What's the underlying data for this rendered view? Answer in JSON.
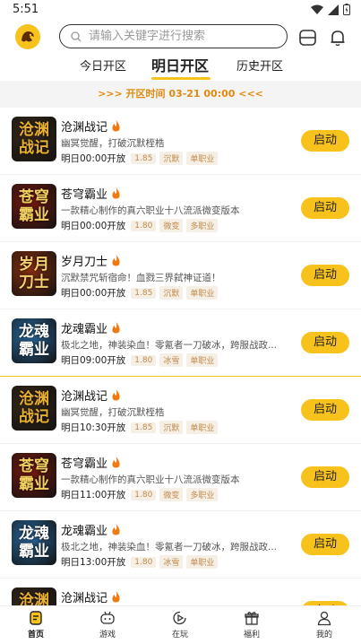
{
  "status": {
    "time": "5:51"
  },
  "header": {
    "search_placeholder": "请输入关键字进行搜索"
  },
  "tabs": [
    {
      "label": "今日开区",
      "active": false
    },
    {
      "label": "明日开区",
      "active": true
    },
    {
      "label": "历史开区",
      "active": false
    }
  ],
  "banner": {
    "text": ">>>  开区时间 03-21 00:00  <<<"
  },
  "start_label": "启动",
  "games": [
    {
      "title": "沧渊战记",
      "thumb": "沧渊战记",
      "thumb_color": "#e8b030",
      "thumb_bg": "#3a2a1a",
      "desc": "幽冥觉醒，打破沉默桎梏",
      "time": "明日00:00开放",
      "tags": [
        "1.85",
        "沉默",
        "单职业"
      ]
    },
    {
      "title": "苍穹霸业",
      "thumb": "苍穹霸业",
      "thumb_color": "#f2d060",
      "thumb_bg": "#7a1a10",
      "desc": "一款精心制作的真六职业十八流派微变版本",
      "time": "明日00:00开放",
      "tags": [
        "1.80",
        "微变",
        "多职业"
      ]
    },
    {
      "title": "岁月刀士",
      "thumb": "岁月刀士",
      "thumb_color": "#f6d070",
      "thumb_bg": "#8a3010",
      "desc": "沉默禁咒斩宿命！血戮三界弑神证道！",
      "time": "明日00:00开放",
      "tags": [
        "1.85",
        "沉默",
        "单职业"
      ]
    },
    {
      "title": "龙魂霸业",
      "thumb": "龙魂霸业",
      "thumb_color": "#ffffff",
      "thumb_bg": "#2a6aa0",
      "desc": "极北之地，神装染血！零氪者一刀破冰，跨服战政...",
      "time": "明日09:00开放",
      "tags": [
        "1.80",
        "冰雪",
        "单职业"
      ]
    },
    {
      "title": "沧渊战记",
      "thumb": "沧渊战记",
      "thumb_color": "#e8b030",
      "thumb_bg": "#3a2a1a",
      "desc": "幽冥觉醒，打破沉默桎梏",
      "time": "明日10:30开放",
      "tags": [
        "1.85",
        "沉默",
        "单职业"
      ]
    },
    {
      "title": "苍穹霸业",
      "thumb": "苍穹霸业",
      "thumb_color": "#f2d060",
      "thumb_bg": "#7a1a10",
      "desc": "一款精心制作的真六职业十八流派微变版本",
      "time": "明日11:00开放",
      "tags": [
        "1.80",
        "微变",
        "多职业"
      ]
    },
    {
      "title": "龙魂霸业",
      "thumb": "龙魂霸业",
      "thumb_color": "#ffffff",
      "thumb_bg": "#2a6aa0",
      "desc": "极北之地，神装染血！零氪者一刀破冰，跨服战政...",
      "time": "明日13:00开放",
      "tags": [
        "1.80",
        "冰雪",
        "单职业"
      ]
    },
    {
      "title": "沧渊战记",
      "thumb": "沧渊战记",
      "thumb_color": "#e8b030",
      "thumb_bg": "#3a2a1a",
      "desc": "",
      "time": "",
      "tags": []
    }
  ],
  "nav": [
    {
      "label": "首页",
      "icon": "home-icon",
      "active": true
    },
    {
      "label": "游戏",
      "icon": "gamepad-icon",
      "active": false
    },
    {
      "label": "在玩",
      "icon": "play-icon",
      "active": false
    },
    {
      "label": "福利",
      "icon": "gift-icon",
      "active": false
    },
    {
      "label": "我的",
      "icon": "user-icon",
      "active": false
    }
  ],
  "colors": {
    "accent": "#f8c21c",
    "banner_text": "#e08a10",
    "tag_text": "#c08a4a",
    "tag_bg": "#f6efe6"
  }
}
